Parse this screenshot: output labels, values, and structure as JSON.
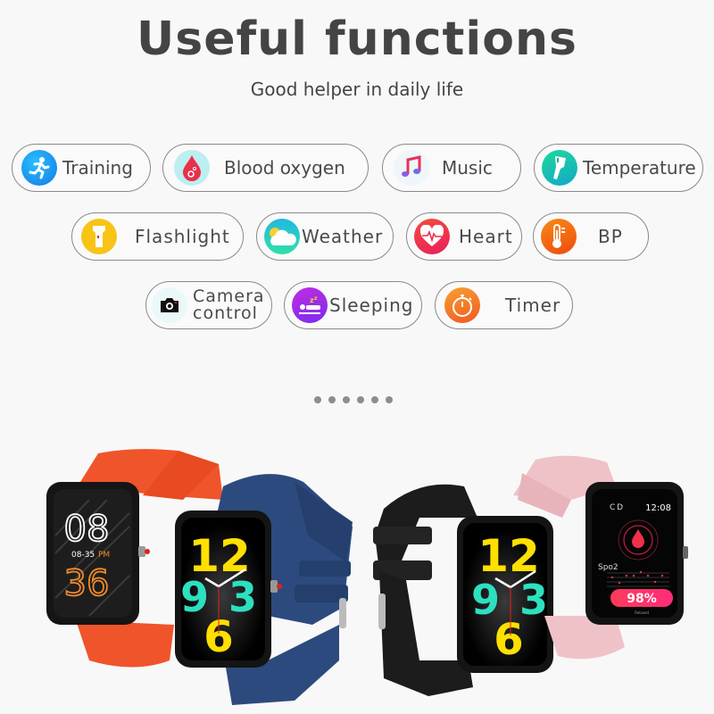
{
  "header": {
    "title": "Useful functions",
    "subtitle": "Good helper in daily life"
  },
  "features": [
    {
      "label": "Training",
      "icon": "running-person-icon",
      "color": "#1a8ff0"
    },
    {
      "label": "Blood oxygen",
      "icon": "blood-drop-icon",
      "color": "#e8304a"
    },
    {
      "label": "Music",
      "icon": "music-note-icon",
      "color": "#e8305a"
    },
    {
      "label": "Temperature",
      "icon": "thermometer-gun-icon",
      "color": "#1ab8a0"
    },
    {
      "label": "Flashlight",
      "icon": "flashlight-icon",
      "color": "#f7c416"
    },
    {
      "label": "Weather",
      "icon": "cloud-sun-icon",
      "color": "#2cc6c0"
    },
    {
      "label": "Heart",
      "icon": "heart-rate-icon",
      "color": "#ef3450"
    },
    {
      "label": "BP",
      "icon": "thermometer-icon",
      "color": "#f26a0f"
    },
    {
      "label_line1": "Camera",
      "label_line2": "control",
      "icon": "camera-icon",
      "color": "#111111"
    },
    {
      "label": "Sleeping",
      "icon": "sleep-icon",
      "color": "#9b2be0"
    },
    {
      "label": "Timer",
      "icon": "stopwatch-icon",
      "color": "#f07a20"
    }
  ],
  "carousel": {
    "dot_count": 6
  },
  "watches": {
    "orange": {
      "band_color": "#f0542a",
      "hour": "08",
      "date_time": "08-35",
      "ampm": "PM",
      "minute": "36"
    },
    "blue": {
      "band_color": "#2d4a7e",
      "dial": [
        "12",
        "9",
        "3",
        "6"
      ]
    },
    "black": {
      "band_color": "#1c1c1c",
      "dial": [
        "12",
        "9",
        "3",
        "6"
      ]
    },
    "pink": {
      "band_color": "#efc2c8",
      "time": "12:08",
      "metric_label": "Spo2",
      "value": "98%",
      "status": "Relaxed",
      "link_icon": "C D"
    }
  }
}
